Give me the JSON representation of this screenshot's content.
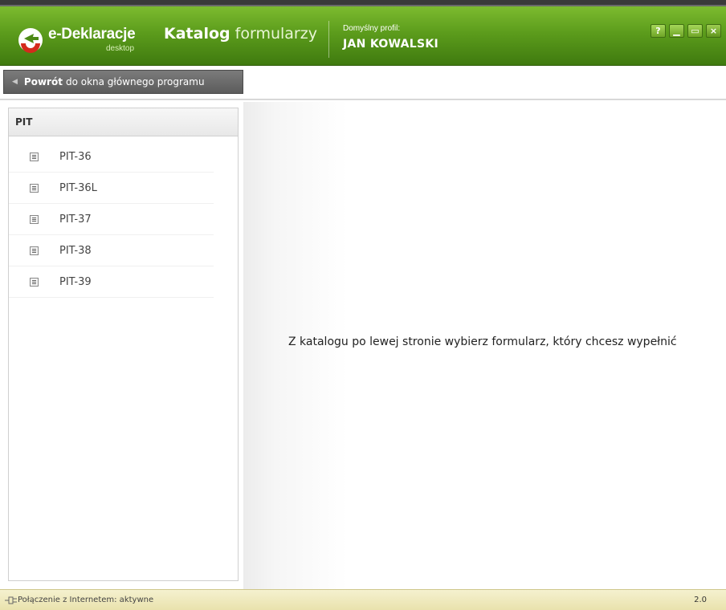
{
  "app": {
    "logo_text": "e-Deklaracje",
    "logo_sub": "desktop",
    "title_bold": "Katalog",
    "title_rest": "formularzy",
    "profile_label": "Domyślny profil:",
    "profile_name": "JAN KOWALSKI",
    "window_buttons": [
      {
        "name": "help",
        "glyph": "?"
      },
      {
        "name": "minimize",
        "glyph": "▁"
      },
      {
        "name": "maximize",
        "glyph": "▭"
      },
      {
        "name": "close",
        "glyph": "×"
      }
    ]
  },
  "back": {
    "bold": "Powrót",
    "rest": "do okna głównego programu"
  },
  "catalog": {
    "group": "PIT",
    "items": [
      "PIT-36",
      "PIT-36L",
      "PIT-37",
      "PIT-38",
      "PIT-39"
    ]
  },
  "main": {
    "message": "Z katalogu po lewej stronie wybierz formularz, który chcesz wypełnić"
  },
  "status": {
    "connection": "Połączenie z Internetem: aktywne",
    "version": "2.0"
  },
  "colors": {
    "header_green": "#5c9c1c",
    "back_gray": "#666666",
    "status_bg": "#efe8bd"
  }
}
